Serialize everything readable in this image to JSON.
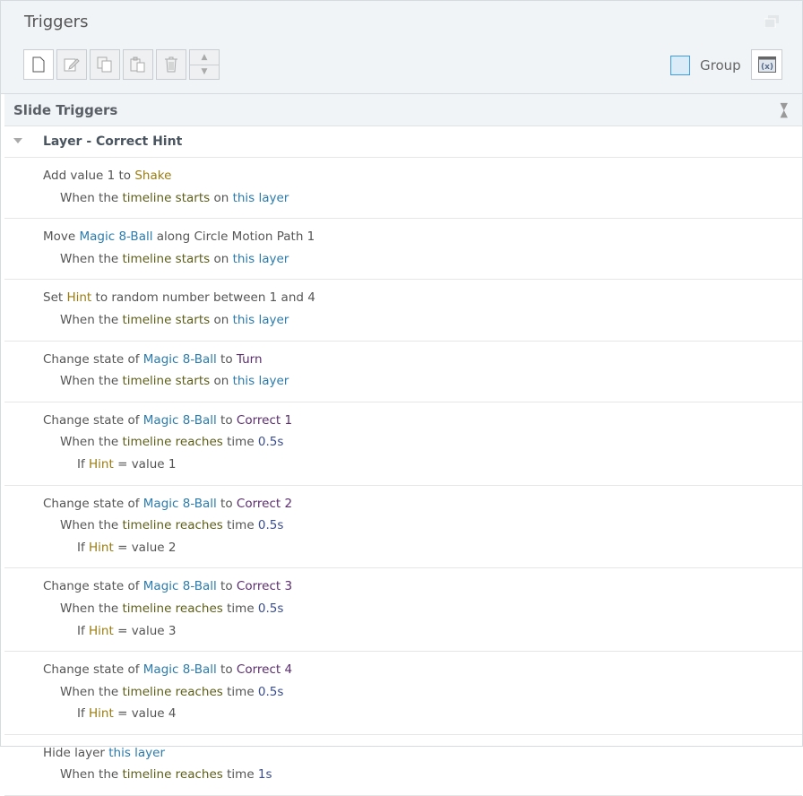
{
  "header": {
    "title": "Triggers",
    "group_label": "Group"
  },
  "section": {
    "title": "Slide Triggers"
  },
  "layer": {
    "title": "Layer - Correct Hint"
  },
  "colors": {
    "variable": "#9a7d12",
    "object": "#2b7bad",
    "event": "#5c5e18",
    "state": "#5b2d6e",
    "number": "#3a4d8c",
    "checkbox": "#3f9ae0"
  },
  "triggers": [
    [
      [
        [
          "plain",
          "Add value 1 to "
        ],
        [
          "var",
          "Shake"
        ]
      ],
      [
        [
          "plain",
          "When the "
        ],
        [
          "event",
          "timeline starts"
        ],
        [
          "plain",
          " on "
        ],
        [
          "obj",
          "this layer"
        ]
      ]
    ],
    [
      [
        [
          "plain",
          "Move "
        ],
        [
          "obj",
          "Magic 8-Ball"
        ],
        [
          "plain",
          " along Circle Motion Path 1"
        ]
      ],
      [
        [
          "plain",
          "When the "
        ],
        [
          "event",
          "timeline starts"
        ],
        [
          "plain",
          " on "
        ],
        [
          "obj",
          "this layer"
        ]
      ]
    ],
    [
      [
        [
          "plain",
          "Set "
        ],
        [
          "var",
          "Hint"
        ],
        [
          "plain",
          " to random number between 1 and 4"
        ]
      ],
      [
        [
          "plain",
          "When the "
        ],
        [
          "event",
          "timeline starts"
        ],
        [
          "plain",
          " on "
        ],
        [
          "obj",
          "this layer"
        ]
      ]
    ],
    [
      [
        [
          "plain",
          "Change state of "
        ],
        [
          "obj",
          "Magic 8-Ball"
        ],
        [
          "plain",
          " to "
        ],
        [
          "state",
          "Turn"
        ]
      ],
      [
        [
          "plain",
          "When the "
        ],
        [
          "event",
          "timeline starts"
        ],
        [
          "plain",
          " on "
        ],
        [
          "obj",
          "this layer"
        ]
      ]
    ],
    [
      [
        [
          "plain",
          "Change state of "
        ],
        [
          "obj",
          "Magic 8-Ball"
        ],
        [
          "plain",
          " to "
        ],
        [
          "state",
          "Correct 1"
        ]
      ],
      [
        [
          "plain",
          "When the "
        ],
        [
          "event",
          "timeline reaches"
        ],
        [
          "plain",
          " time "
        ],
        [
          "num",
          "0.5s"
        ]
      ],
      [
        [
          "plain",
          "If "
        ],
        [
          "var",
          "Hint"
        ],
        [
          "plain",
          " = value 1"
        ]
      ]
    ],
    [
      [
        [
          "plain",
          "Change state of "
        ],
        [
          "obj",
          "Magic 8-Ball"
        ],
        [
          "plain",
          " to "
        ],
        [
          "state",
          "Correct 2"
        ]
      ],
      [
        [
          "plain",
          "When the "
        ],
        [
          "event",
          "timeline reaches"
        ],
        [
          "plain",
          " time "
        ],
        [
          "num",
          "0.5s"
        ]
      ],
      [
        [
          "plain",
          "If "
        ],
        [
          "var",
          "Hint"
        ],
        [
          "plain",
          " = value 2"
        ]
      ]
    ],
    [
      [
        [
          "plain",
          "Change state of "
        ],
        [
          "obj",
          "Magic 8-Ball"
        ],
        [
          "plain",
          " to "
        ],
        [
          "state",
          "Correct 3"
        ]
      ],
      [
        [
          "plain",
          "When the "
        ],
        [
          "event",
          "timeline reaches"
        ],
        [
          "plain",
          " time "
        ],
        [
          "num",
          "0.5s"
        ]
      ],
      [
        [
          "plain",
          "If "
        ],
        [
          "var",
          "Hint"
        ],
        [
          "plain",
          " = value 3"
        ]
      ]
    ],
    [
      [
        [
          "plain",
          "Change state of "
        ],
        [
          "obj",
          "Magic 8-Ball"
        ],
        [
          "plain",
          " to "
        ],
        [
          "state",
          "Correct 4"
        ]
      ],
      [
        [
          "plain",
          "When the "
        ],
        [
          "event",
          "timeline reaches"
        ],
        [
          "plain",
          " time "
        ],
        [
          "num",
          "0.5s"
        ]
      ],
      [
        [
          "plain",
          "If "
        ],
        [
          "var",
          "Hint"
        ],
        [
          "plain",
          " = value 4"
        ]
      ]
    ],
    [
      [
        [
          "plain",
          "Hide layer "
        ],
        [
          "obj",
          "this layer"
        ]
      ],
      [
        [
          "plain",
          "When the "
        ],
        [
          "event",
          "timeline reaches"
        ],
        [
          "plain",
          " time "
        ],
        [
          "num",
          "1s"
        ]
      ]
    ]
  ]
}
